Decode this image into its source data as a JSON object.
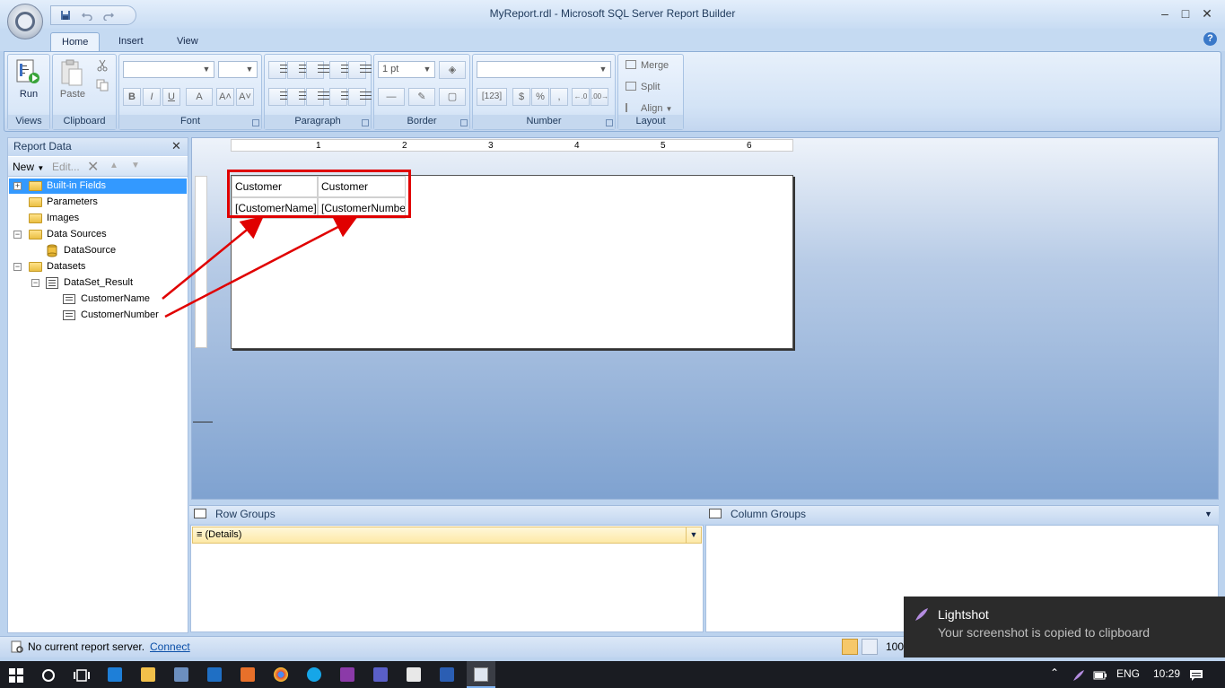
{
  "window": {
    "title": "MyReport.rdl - Microsoft SQL Server Report Builder",
    "minimize": "–",
    "maximize": "□",
    "close": "✕"
  },
  "ribbon": {
    "tabs": [
      {
        "label": "Home",
        "active": true
      },
      {
        "label": "Insert",
        "active": false
      },
      {
        "label": "View",
        "active": false
      }
    ],
    "help": "?",
    "groups": {
      "views": {
        "label": "Views",
        "run_label": "Run"
      },
      "clipboard": {
        "label": "Clipboard",
        "paste_label": "Paste"
      },
      "font": {
        "label": "Font",
        "bold": "B",
        "italic": "I",
        "underline": "U",
        "color": "A",
        "grow": "A˄",
        "shrink": "A˅"
      },
      "paragraph": {
        "label": "Paragraph"
      },
      "border": {
        "label": "Border",
        "width_value": "1 pt"
      },
      "number": {
        "label": "Number",
        "placeholders": "[123]",
        "currency": "$",
        "percent": "%",
        "comma": ",",
        "inc_dec": "←.0",
        "dec_dec": ".00→"
      },
      "layout": {
        "label": "Layout",
        "merge": "Merge",
        "split": "Split",
        "align": "Align"
      }
    }
  },
  "report_data": {
    "title": "Report Data",
    "close": "✕",
    "toolbar": {
      "new": "New",
      "edit": "Edit..."
    },
    "tree": {
      "builtin_fields": "Built-in Fields",
      "parameters": "Parameters",
      "images": "Images",
      "data_sources": "Data Sources",
      "datasource": "DataSource",
      "datasets": "Datasets",
      "dataset_result": "DataSet_Result",
      "field_customer_name": "CustomerName",
      "field_customer_number": "CustomerNumber"
    }
  },
  "ruler": {
    "marks": [
      "1",
      "2",
      "3",
      "4",
      "5",
      "6"
    ]
  },
  "tablix": {
    "headers": [
      "Customer",
      "Customer"
    ],
    "fields": [
      "[CustomerName]",
      "[CustomerNumber]"
    ]
  },
  "groups": {
    "row_label": "Row Groups",
    "column_label": "Column Groups",
    "details": "(Details)"
  },
  "status": {
    "text": "No current report server.",
    "connect": "Connect",
    "zoom": "100"
  },
  "toast": {
    "app": "Lightshot",
    "message": "Your screenshot is copied to clipboard"
  },
  "taskbar": {
    "language": "ENG",
    "time": "10:29"
  },
  "colors": {
    "annotation_red": "#e00000",
    "selection_blue": "#3399ff",
    "ribbon_blue": "#c5daf2"
  }
}
